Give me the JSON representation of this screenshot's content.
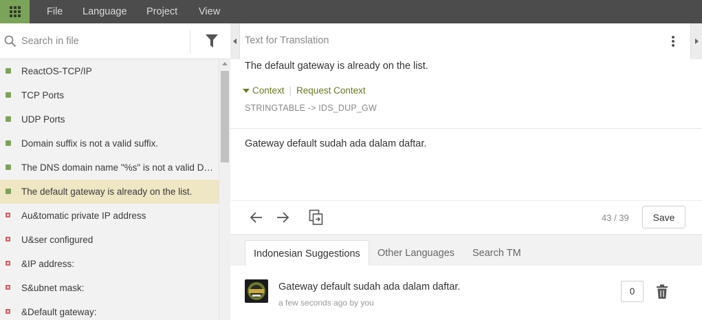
{
  "menubar": {
    "items": [
      "File",
      "Language",
      "Project",
      "View"
    ],
    "accent_color": "#7ba45a"
  },
  "search": {
    "placeholder": "Search in file"
  },
  "strings": [
    {
      "label": "ReactOS-TCP/IP",
      "status": "translated"
    },
    {
      "label": "TCP Ports",
      "status": "translated"
    },
    {
      "label": "UDP Ports",
      "status": "translated"
    },
    {
      "label": "Domain suffix is not a valid suffix.",
      "status": "translated"
    },
    {
      "label": "The DNS domain name \"%s\" is not a valid DNS name.",
      "status": "translated"
    },
    {
      "label": "The default gateway is already on the list.",
      "status": "translated",
      "selected": true
    },
    {
      "label": "Au&tomatic private IP address",
      "status": "untranslated"
    },
    {
      "label": "U&ser configured",
      "status": "untranslated"
    },
    {
      "label": "&IP address:",
      "status": "untranslated"
    },
    {
      "label": "S&ubnet mask:",
      "status": "untranslated"
    },
    {
      "label": "&Default gateway:",
      "status": "untranslated"
    }
  ],
  "editor": {
    "source_header": "Text for Translation",
    "source_text": "The default gateway is already on the list.",
    "context_label": "Context",
    "request_context_label": "Request Context",
    "context_key": "STRINGTABLE -> IDS_DUP_GW",
    "translation": "Gateway default sudah ada dalam daftar.",
    "char_count": "43 / 39",
    "save_label": "Save"
  },
  "tabs": [
    "Indonesian Suggestions",
    "Other Languages",
    "Search TM"
  ],
  "suggestion": {
    "text": "Gateway default sudah ada dalam daftar.",
    "meta": "a few seconds ago by you",
    "count": "0"
  },
  "colors": {
    "translated": "#7ba45a",
    "untranslated": "#e05b63",
    "selected_row": "#efe6c4",
    "context_link": "#6a7a1e"
  }
}
